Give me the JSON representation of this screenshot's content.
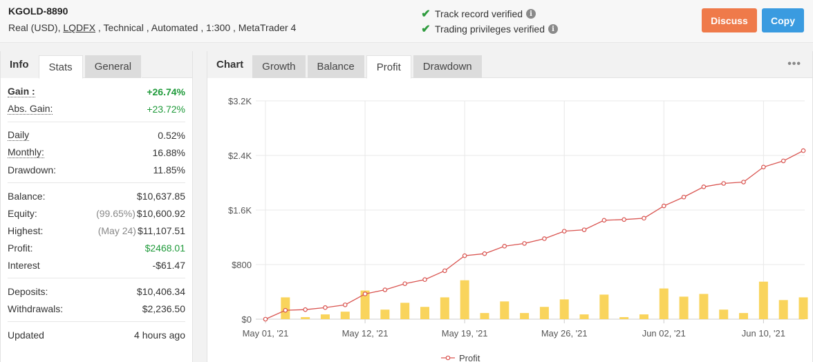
{
  "header": {
    "account_name": "KGOLD-8890",
    "meta_prefix": "Real (USD), ",
    "broker": "LQDFX",
    "meta_suffix": " , Technical , Automated , 1:300 , MetaTrader 4",
    "verify_track": "Track record verified",
    "verify_trading": "Trading privileges verified",
    "discuss_label": "Discuss",
    "copy_label": "Copy"
  },
  "left_tabs": {
    "label": "Info",
    "stats": "Stats",
    "general": "General"
  },
  "stats": {
    "gain": {
      "label": "Gain :",
      "value": "+26.74%"
    },
    "abs_gain": {
      "label": "Abs. Gain:",
      "value": "+23.72%"
    },
    "daily": {
      "label": "Daily",
      "value": "0.52%"
    },
    "monthly": {
      "label": "Monthly:",
      "value": "16.88%"
    },
    "drawdown": {
      "label": "Drawdown:",
      "value": "11.85%"
    },
    "balance": {
      "label": "Balance:",
      "value": "$10,637.85"
    },
    "equity": {
      "label": "Equity:",
      "sub": "(99.65%)",
      "value": "$10,600.92"
    },
    "highest": {
      "label": "Highest:",
      "sub": "(May 24)",
      "value": "$11,107.51"
    },
    "profit": {
      "label": "Profit:",
      "value": "$2468.01"
    },
    "interest": {
      "label": "Interest",
      "value": "-$61.47"
    },
    "deposits": {
      "label": "Deposits:",
      "value": "$10,406.34"
    },
    "withdrawals": {
      "label": "Withdrawals:",
      "value": "$2,236.50"
    },
    "updated": {
      "label": "Updated",
      "value": "4 hours ago"
    }
  },
  "right_tabs": {
    "label": "Chart",
    "growth": "Growth",
    "balance": "Balance",
    "profit": "Profit",
    "drawdown": "Drawdown",
    "more": "•••"
  },
  "colors": {
    "line": "#d9534f",
    "bar": "#f9d45c",
    "discuss": "#ef7a4a",
    "copy": "#3a9be0",
    "positive": "#1f9a3a"
  },
  "chart_data": {
    "type": "line",
    "ylim": [
      0,
      3200
    ],
    "yticks": [
      0,
      800,
      1600,
      2400,
      3200
    ],
    "ytick_labels": [
      "$0",
      "$800",
      "$1.6K",
      "$2.4K",
      "$3.2K"
    ],
    "xtick_labels": [
      "May 01, '21",
      "May 12, '21",
      "May 19, '21",
      "May 26, '21",
      "Jun 02, '21",
      "Jun 10, '21"
    ],
    "xtick_index": [
      0,
      5,
      10,
      15,
      20,
      25
    ],
    "legend": "Profit",
    "legend_position": "bottom-center",
    "series": [
      {
        "name": "Profit",
        "type": "line",
        "values": [
          0,
          130,
          140,
          170,
          210,
          370,
          430,
          520,
          580,
          710,
          930,
          960,
          1070,
          1110,
          1180,
          1290,
          1310,
          1450,
          1460,
          1480,
          1660,
          1790,
          1940,
          1990,
          2010,
          2230,
          2320,
          2470
        ]
      },
      {
        "type": "bar",
        "values": [
          0,
          320,
          30,
          70,
          110,
          420,
          140,
          240,
          180,
          320,
          570,
          90,
          260,
          90,
          180,
          290,
          70,
          360,
          30,
          70,
          450,
          330,
          370,
          140,
          90,
          550,
          280,
          320
        ]
      }
    ]
  }
}
